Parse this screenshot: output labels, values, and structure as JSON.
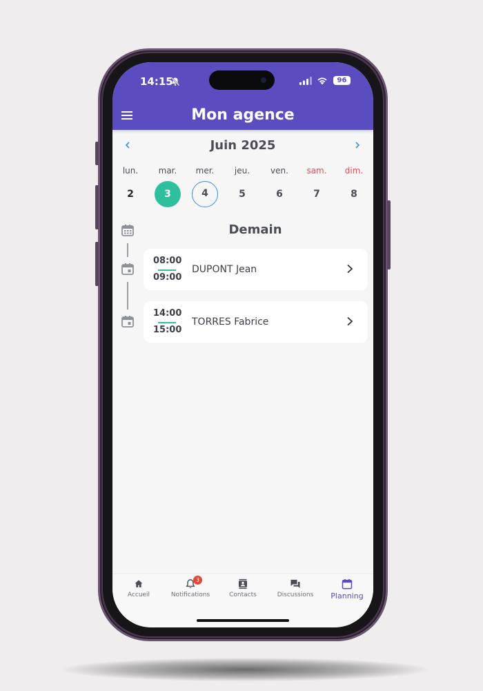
{
  "status": {
    "time": "14:15",
    "battery": "96"
  },
  "header": {
    "title": "Mon agence"
  },
  "calendar": {
    "month": "Juin 2025",
    "days": [
      {
        "name": "lun.",
        "num": "2"
      },
      {
        "name": "mar.",
        "num": "3"
      },
      {
        "name": "mer.",
        "num": "4"
      },
      {
        "name": "jeu.",
        "num": "5"
      },
      {
        "name": "ven.",
        "num": "6"
      },
      {
        "name": "sam.",
        "num": "7"
      },
      {
        "name": "dim.",
        "num": "8"
      }
    ]
  },
  "agenda": {
    "section_title": "Demain",
    "appointments": [
      {
        "start": "08:00",
        "end": "09:00",
        "name": "DUPONT Jean"
      },
      {
        "start": "14:00",
        "end": "15:00",
        "name": "TORRES Fabrice"
      }
    ]
  },
  "tabs": [
    {
      "label": "Accueil",
      "icon": "home-icon"
    },
    {
      "label": "Notifications",
      "icon": "bell-icon",
      "badge": "3"
    },
    {
      "label": "Contacts",
      "icon": "contacts-icon"
    },
    {
      "label": "Discussions",
      "icon": "chat-icon"
    },
    {
      "label": "Planning",
      "icon": "calendar-icon"
    }
  ],
  "colors": {
    "header": "#5a4dbf",
    "selected_day": "#2fbf9f",
    "today_ring": "#3a8ee0",
    "weekend": "#e04a5a",
    "badge": "#e2473b"
  }
}
